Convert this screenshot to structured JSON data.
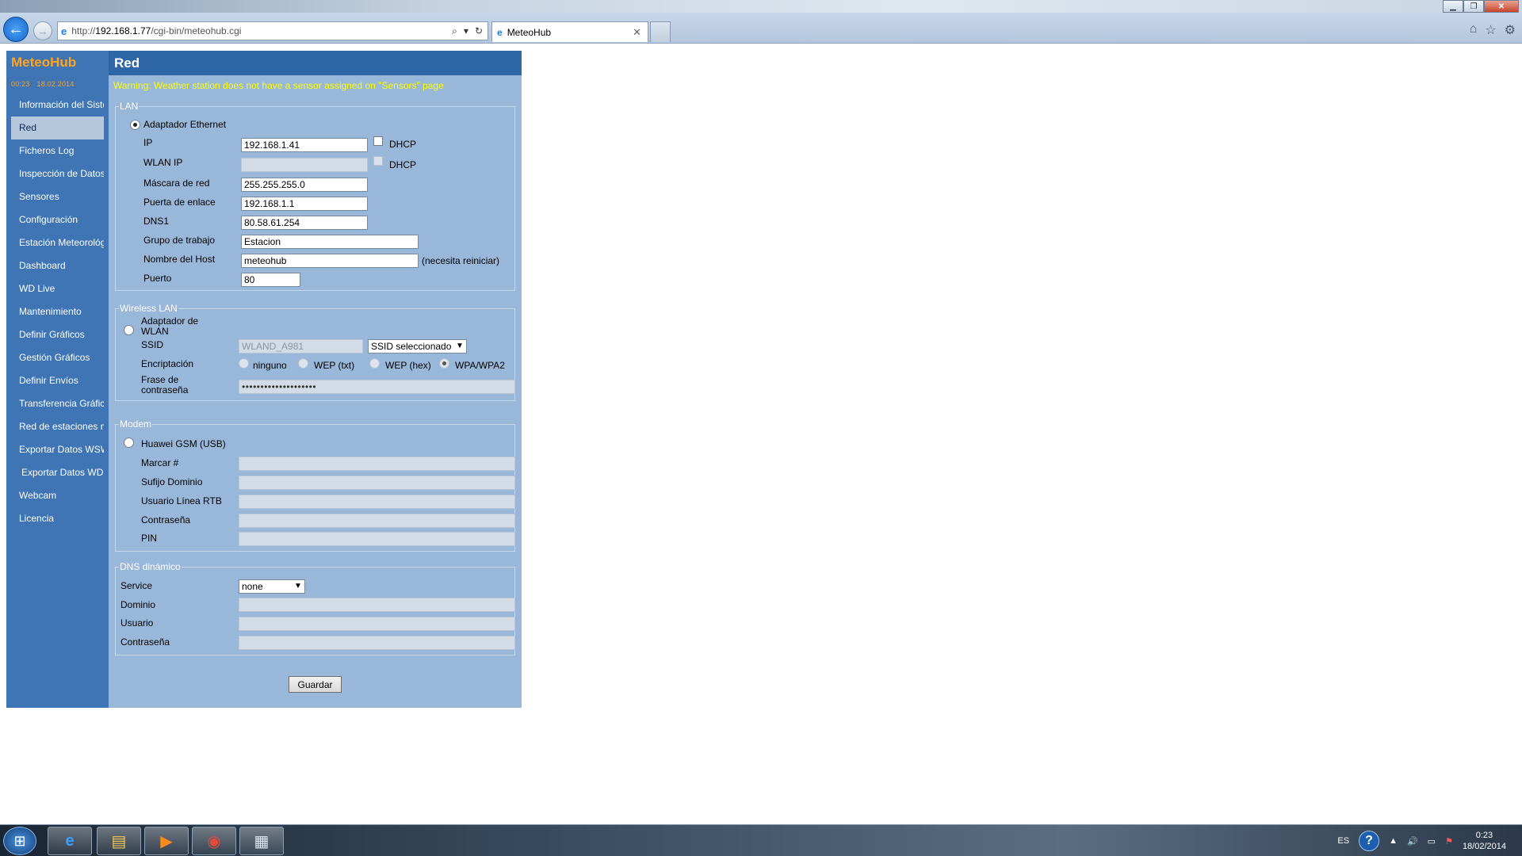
{
  "browser": {
    "url_prefix": "http://",
    "url_host": "192.168.1.77",
    "url_path": "/cgi-bin/meteohub.cgi",
    "tab_title": "MeteoHub",
    "tab_close": "✕",
    "icons": [
      "back-arrow-icon",
      "forward-arrow-icon",
      "search-icon",
      "refresh-icon",
      "home-icon",
      "favorites-star-icon",
      "settings-gear-icon"
    ]
  },
  "sidebar": {
    "brand": "MeteoHub",
    "time": "00:23",
    "date": "18.02.2014",
    "items": [
      {
        "label": "Información del Sistema"
      },
      {
        "label": "Red"
      },
      {
        "label": "Ficheros Log"
      },
      {
        "label": "Inspección de Datos"
      },
      {
        "label": "Sensores"
      },
      {
        "label": "Configuración"
      },
      {
        "label": "Estación Meteorológica"
      },
      {
        "label": "Dashboard"
      },
      {
        "label": "WD Live"
      },
      {
        "label": "Mantenimiento"
      },
      {
        "label": "Definir Gráficos"
      },
      {
        "label": "Gestión Gráficos"
      },
      {
        "label": "Definir Envíos"
      },
      {
        "label": "Transferencia Gráficos"
      },
      {
        "label": "Red de estaciones meteo"
      },
      {
        "label": "Exportar Datos WSW"
      },
      {
        "label": " Exportar Datos WD"
      },
      {
        "label": "Webcam"
      },
      {
        "label": "Licencia"
      }
    ],
    "active_index": 1
  },
  "page": {
    "title": "Red",
    "warning": "Warning: Weather station does not have a sensor assigned on \"Sensors\" page"
  },
  "lan": {
    "legend": "LAN",
    "adapter_label": "Adaptador Ethernet",
    "ip_label": "IP",
    "ip_value": "192.168.1.41",
    "dhcp_label": "DHCP",
    "wlan_ip_label": "WLAN IP",
    "wlan_dhcp_label": "DHCP",
    "mask_label": "Máscara de red",
    "mask_value": "255.255.255.0",
    "gateway_label": "Puerta de enlace",
    "gateway_value": "192.168.1.1",
    "dns1_label": "DNS1",
    "dns1_value": "80.58.61.254",
    "workgroup_label": "Grupo de trabajo",
    "workgroup_value": "Estacion",
    "hostname_label": "Nombre del Host",
    "hostname_value": "meteohub",
    "hostname_note": "(necesita reiniciar)",
    "port_label": "Puerto",
    "port_value": "80"
  },
  "wlan": {
    "legend": "Wireless LAN",
    "adapter_label_line1": "Adaptador de",
    "adapter_label_line2": "WLAN",
    "ssid_label": "SSID",
    "ssid_value": "WLAND_A981",
    "ssid_select": "SSID seleccionado",
    "encryption_label": "Encriptación",
    "enc_options": [
      "ninguno",
      "WEP (txt)",
      "WEP (hex)",
      "WPA/WPA2"
    ],
    "enc_selected": "WPA/WPA2",
    "passphrase_label_line1": "Frase de",
    "passphrase_label_line2": "contraseña",
    "passphrase_value": "••••••••••••••••••••"
  },
  "modem": {
    "legend": "Modem",
    "adapter_label": "Huawei GSM (USB)",
    "dial_label": "Marcar #",
    "suffix_label": "Sufijo Dominio",
    "user_label": "Usuario Línea RTB",
    "password_label": "Contraseña",
    "pin_label": "PIN"
  },
  "ddns": {
    "legend": "DNS dinámico",
    "service_label": "Service",
    "service_value": "none",
    "domain_label": "Dominio",
    "user_label": "Usuario",
    "password_label": "Contraseña"
  },
  "actions": {
    "save_label": "Guardar"
  },
  "taskbar": {
    "language": "ES",
    "time": "0:23",
    "date": "18/02/2014"
  }
}
